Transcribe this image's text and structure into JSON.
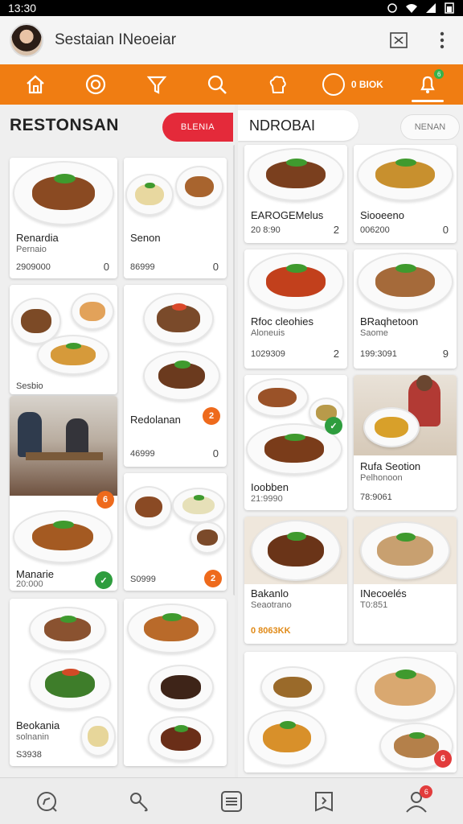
{
  "status_bar": {
    "time": "13:30"
  },
  "app_bar": {
    "title": "Sestaian INeoeiar"
  },
  "tabbar": {
    "pill_label": "0 BIOK",
    "dot_count": "6"
  },
  "left_section": {
    "title": "RESTONSAN",
    "chip": "BLENIA"
  },
  "right_section": {
    "title": "NDROBAI",
    "chip": "NENAN"
  },
  "left_cards": [
    {
      "name": "Renardia",
      "sub": "Pernaio",
      "price": "2909000",
      "count": "0"
    },
    {
      "name": "Senon",
      "sub": "",
      "price": "86999",
      "count": "0"
    },
    {
      "name": "",
      "sub": "",
      "price": "Sesbio",
      "count": ""
    },
    {
      "name": "Redolanan",
      "sub": "",
      "price": "46999",
      "count": "0",
      "badge": "2"
    },
    {
      "name": "",
      "sub": "",
      "price": "",
      "count": "",
      "badge": "6"
    },
    {
      "name": "Manarie",
      "sub": "20:000",
      "price": "",
      "count": "",
      "badge": "✓"
    },
    {
      "name": "",
      "sub": "",
      "price": "S0999",
      "count": "",
      "badge": "2"
    },
    {
      "name": "Beokania",
      "sub": "solnanin",
      "price": "S3938",
      "count": ""
    },
    {
      "name": "",
      "sub": "",
      "price": "",
      "count": ""
    }
  ],
  "right_cards": [
    {
      "name": "EAROGEMelus",
      "sub": "",
      "price": "20 8:90",
      "count": "2"
    },
    {
      "name": "Siooeeno",
      "sub": "",
      "price": "006200",
      "count": "0"
    },
    {
      "name": "Rfoc cleohies",
      "sub": "Aloneuis",
      "price": "1029309",
      "count": "2"
    },
    {
      "name": "BRaqhetoon",
      "sub": "Saome",
      "price": "199:3091",
      "count": "9"
    },
    {
      "name": "Ioobben",
      "sub": "21:9990",
      "price": "",
      "count": "",
      "badge": "✓"
    },
    {
      "name": "Rufa Seotion",
      "sub": "Pelhonoon",
      "price": "78:9061",
      "count": ""
    },
    {
      "name": "Bakanlo",
      "sub": "Seaotrano",
      "price": "0 8063KK",
      "count": ""
    },
    {
      "name": "INecoelés",
      "sub": "T0:851",
      "price": "",
      "count": ""
    },
    {
      "name": "",
      "sub": "",
      "price": "",
      "count": "",
      "badge": "6"
    }
  ],
  "bottom_nav": {
    "badge": "6"
  }
}
